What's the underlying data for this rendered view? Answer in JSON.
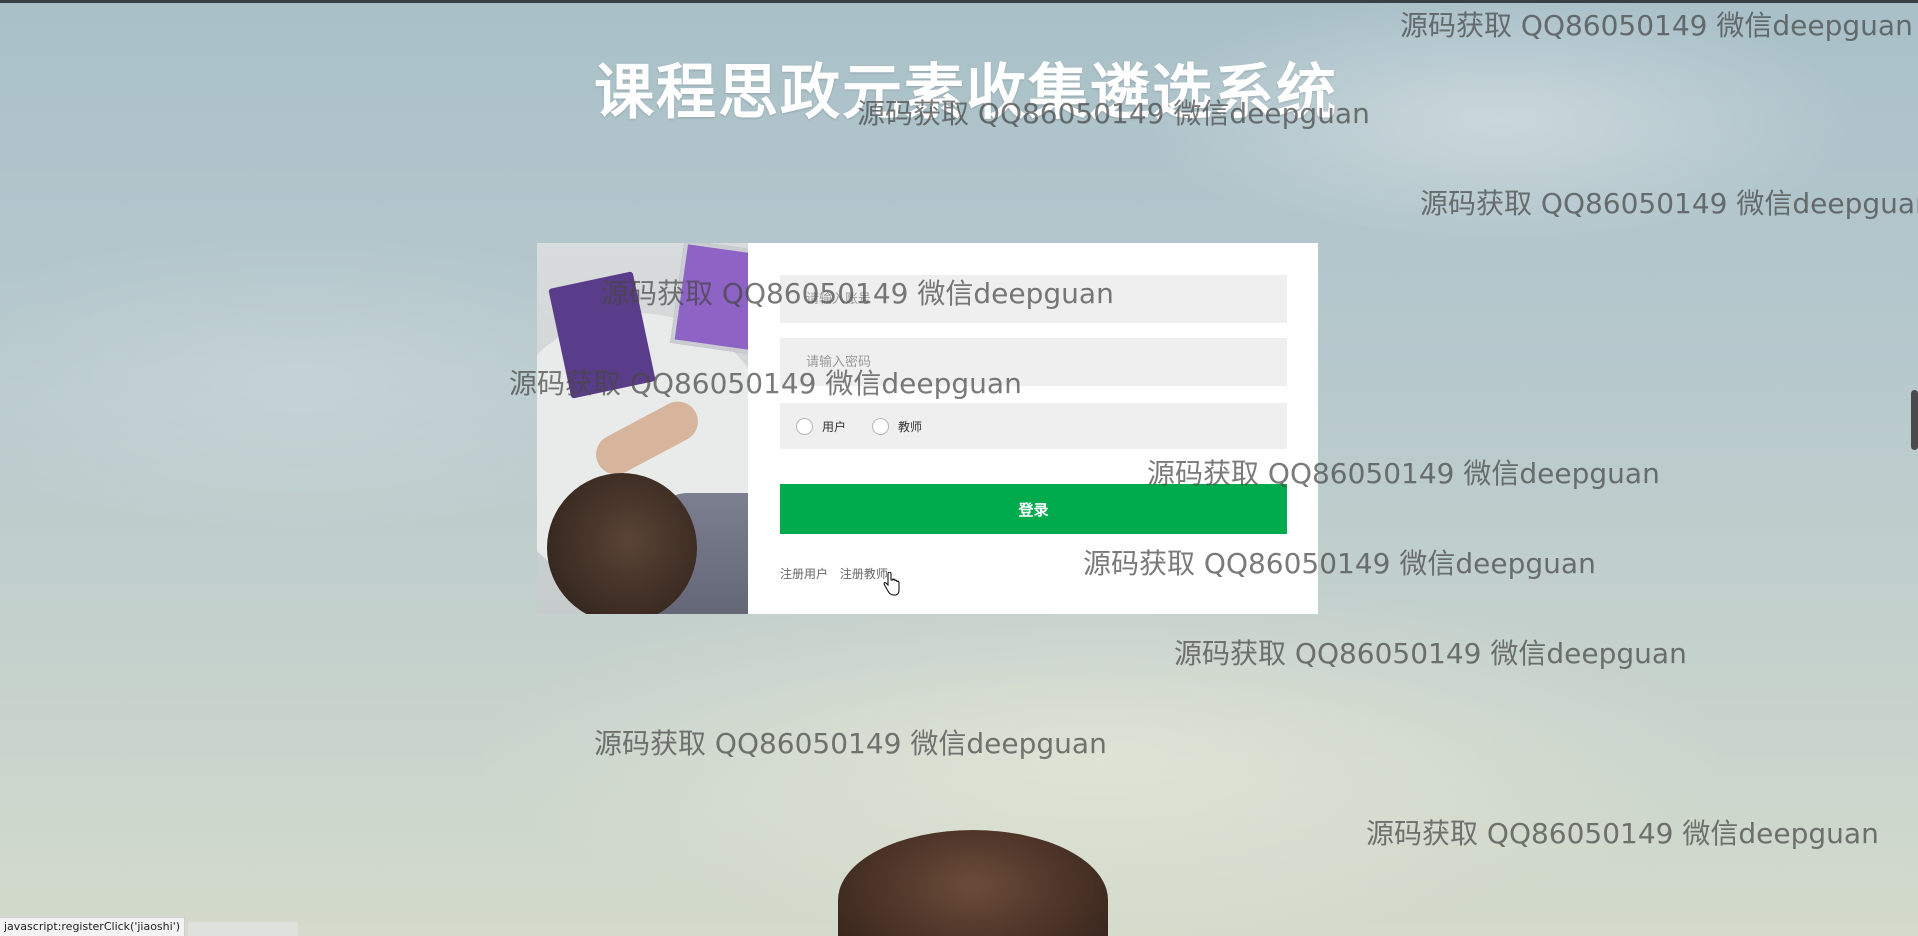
{
  "page": {
    "title": "课程思政元素收集遴选系统"
  },
  "login_form": {
    "account_placeholder": "请输入账号",
    "password_placeholder": "请输入密码",
    "roles": [
      {
        "label": "用户",
        "selected": false
      },
      {
        "label": "教师",
        "selected": false
      }
    ],
    "login_label": "登录",
    "register_links": [
      "注册用户",
      "注册教师"
    ]
  },
  "watermark_text": "源码获取 QQ86050149 微信deepguan",
  "status_bar": {
    "url": "javascript:registerClick('jiaoshi')"
  },
  "colors": {
    "login_button": "#00ab4e",
    "field_background": "#efefef",
    "title_text": "#ffffff"
  }
}
